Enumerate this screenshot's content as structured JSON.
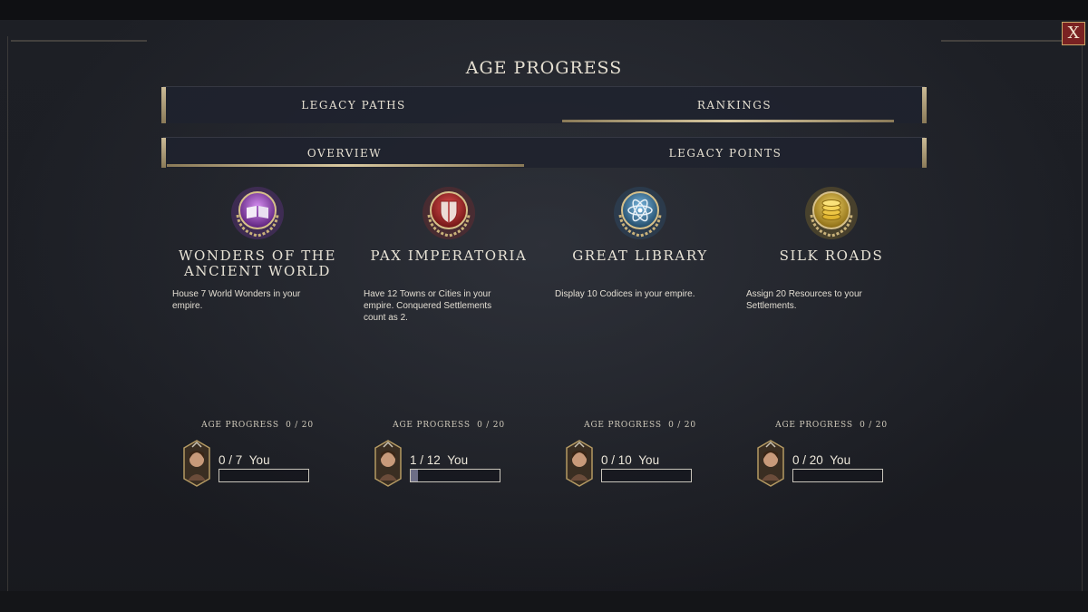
{
  "title": "AGE PROGRESS",
  "close_label": "X",
  "tabs_primary": [
    {
      "label": "LEGACY PATHS",
      "active": false
    },
    {
      "label": "RANKINGS",
      "active": true
    }
  ],
  "tabs_secondary": [
    {
      "label": "OVERVIEW",
      "active": true
    },
    {
      "label": "LEGACY POINTS",
      "active": false
    }
  ],
  "paths": [
    {
      "name": "WONDERS OF THE ANCIENT WORLD",
      "icon": "book-icon",
      "color": "#8a3fb0",
      "description": "House 7 World Wonders in your empire.",
      "age_progress_label": "AGE PROGRESS",
      "age_progress_value": "0 / 20",
      "score": "0 / 7",
      "player": "You",
      "progress": 0.0
    },
    {
      "name": "PAX IMPERATORIA",
      "icon": "shield-icon",
      "color": "#b02a2a",
      "description": "Have 12 Towns or Cities in your empire. Conquered Settlements count as 2.",
      "age_progress_label": "AGE PROGRESS",
      "age_progress_value": "0 / 20",
      "score": "1 / 12",
      "player": "You",
      "progress": 0.0833
    },
    {
      "name": "GREAT LIBRARY",
      "icon": "atom-icon",
      "color": "#2e6b9e",
      "description": "Display 10 Codices in your empire.",
      "age_progress_label": "AGE PROGRESS",
      "age_progress_value": "0 / 20",
      "score": "0 / 10",
      "player": "You",
      "progress": 0.0
    },
    {
      "name": "SILK ROADS",
      "icon": "coins-icon",
      "color": "#c9a227",
      "description": "Assign 20 Resources to your Settlements.",
      "age_progress_label": "AGE PROGRESS",
      "age_progress_value": "0 / 20",
      "score": "0 / 20",
      "player": "You",
      "progress": 0.0
    }
  ]
}
